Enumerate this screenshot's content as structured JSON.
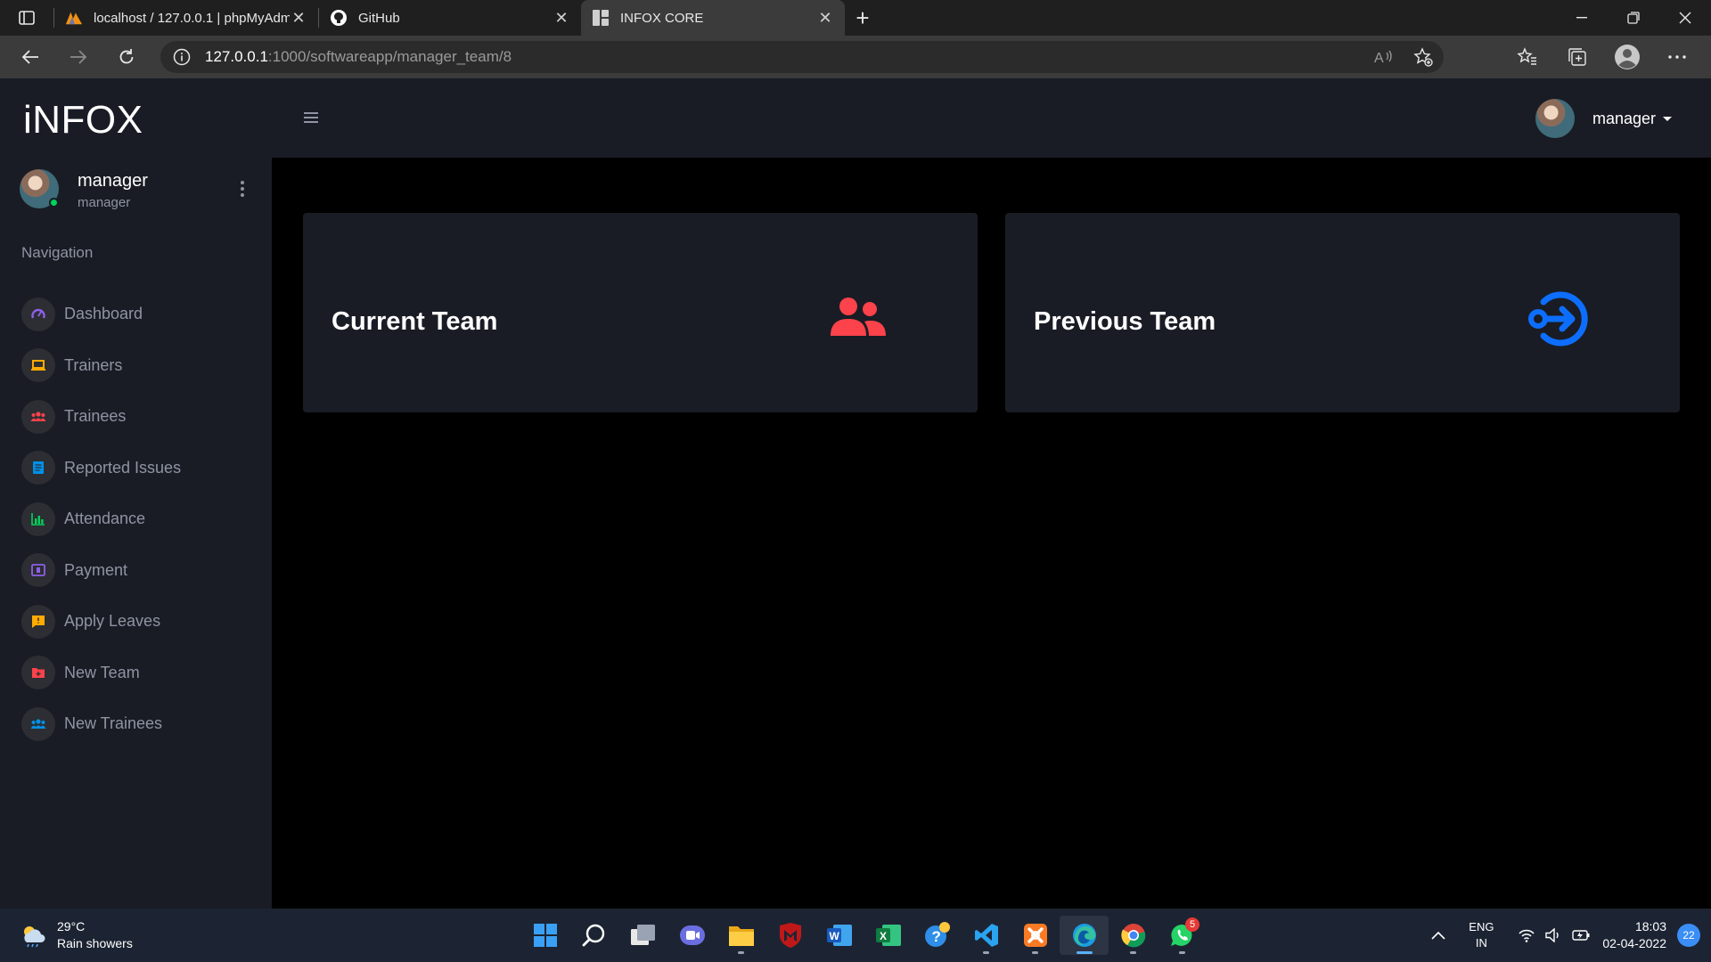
{
  "browser": {
    "tabs": [
      {
        "title": "localhost / 127.0.0.1 | phpMyAdmin",
        "icon": "phpmyadmin-icon"
      },
      {
        "title": "GitHub",
        "icon": "github-icon"
      },
      {
        "title": "INFOX CORE",
        "icon": "page-icon",
        "active": true
      }
    ],
    "url_host": "127.0.0.1",
    "url_path": ":1000/softwareapp/manager_team/8"
  },
  "sidebar": {
    "brand": "iNFOX",
    "profile": {
      "name": "manager",
      "role": "manager"
    },
    "nav_heading": "Navigation",
    "items": [
      {
        "label": "Dashboard",
        "icon": "speedometer-icon",
        "color": "#8f5fe8"
      },
      {
        "label": "Trainers",
        "icon": "laptop-icon",
        "color": "#ffab00"
      },
      {
        "label": "Trainees",
        "icon": "people-icon",
        "color": "#fc424a"
      },
      {
        "label": "Reported Issues",
        "icon": "document-icon",
        "color": "#0090e7"
      },
      {
        "label": "Attendance",
        "icon": "bar-chart-icon",
        "color": "#00d25b"
      },
      {
        "label": "Payment",
        "icon": "wallet-icon",
        "color": "#8f5fe8"
      },
      {
        "label": "Apply Leaves",
        "icon": "message-icon",
        "color": "#ffab00"
      },
      {
        "label": "New Team",
        "icon": "folder-plus-icon",
        "color": "#fc424a"
      },
      {
        "label": "New Trainees",
        "icon": "people-icon",
        "color": "#0090e7"
      }
    ]
  },
  "topbar": {
    "username": "manager"
  },
  "cards": [
    {
      "title": "Current Team",
      "icon": "user-group-icon",
      "color": "#fc424a"
    },
    {
      "title": "Previous Team",
      "icon": "sign-in-circle-icon",
      "color": "#0d6efd"
    }
  ],
  "taskbar": {
    "weather_temp": "29°C",
    "weather_desc": "Rain showers",
    "lang_top": "ENG",
    "lang_bottom": "IN",
    "time": "18:03",
    "date": "02-04-2022",
    "notifications": "22",
    "whatsapp_badge": "5"
  }
}
